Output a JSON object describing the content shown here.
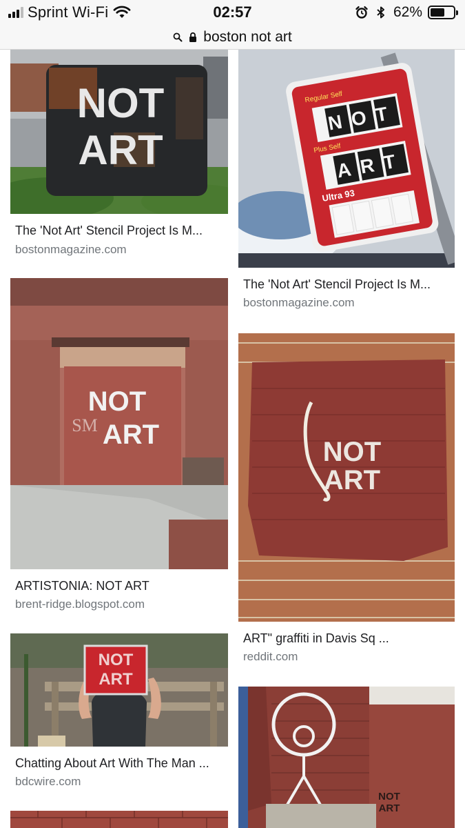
{
  "status_bar": {
    "carrier": "Sprint Wi-Fi",
    "time": "02:57",
    "battery_percent": "62%",
    "battery_level": 0.62,
    "signal_bars_filled": 3,
    "signal_bars_total": 4,
    "icons": [
      "signal-icon",
      "wifi-icon",
      "alarm-icon",
      "bluetooth-icon",
      "battery-icon"
    ]
  },
  "url_bar": {
    "url": "boston not art",
    "icons": [
      "search-icon",
      "lock-icon"
    ]
  },
  "results": [
    {
      "title": "The 'Not Art' Stencil Project Is M...",
      "source": "bostonmagazine.com",
      "image": "black metal box with NOT ART stencil"
    },
    {
      "title": "The 'Not Art' Stencil Project Is M...",
      "source": "bostonmagazine.com",
      "image": "red gas price sign reading NOT ART"
    },
    {
      "title": "ARTISTONIA: NOT ART",
      "source": "brent-ridge.blogspot.com",
      "image": "red painted wall with NOT ART stencil"
    },
    {
      "title": "ART\" graffiti in Davis Sq ...",
      "source": "reddit.com",
      "image": "red painted brick wall with rope and NOT ART"
    },
    {
      "title": "Chatting About Art With The Man ...",
      "source": "bdcwire.com",
      "image": "man holding NOT ART sign on bench"
    },
    {
      "title": "",
      "source": "",
      "image": "graffiti on red brick wall with NOT ART"
    },
    {
      "title": "",
      "source": "",
      "image": "red brick wall (partially visible)"
    }
  ],
  "image_text": {
    "not": "NOT",
    "art": "ART",
    "sm": "SM",
    "ultra": "Ultra 93",
    "regular": "Regular Self",
    "plus": "Plus Self"
  },
  "colors": {
    "status_bg": "#f7f7f7",
    "caption_text": "#202124",
    "source_text": "#70757a",
    "brick_red": "#8e3a34",
    "sign_red": "#c8262d"
  }
}
